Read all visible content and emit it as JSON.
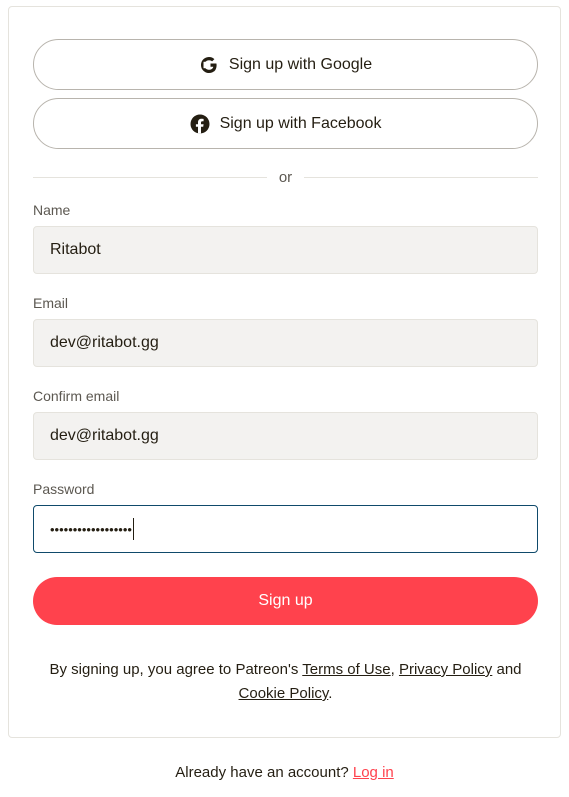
{
  "social": {
    "google_label": "Sign up with Google",
    "facebook_label": "Sign up with Facebook"
  },
  "divider": {
    "text": "or"
  },
  "form": {
    "name": {
      "label": "Name",
      "value": "Ritabot"
    },
    "email": {
      "label": "Email",
      "value": "dev@ritabot.gg"
    },
    "confirm_email": {
      "label": "Confirm email",
      "value": "dev@ritabot.gg"
    },
    "password": {
      "label": "Password",
      "masked_value": "••••••••••••••••••"
    }
  },
  "signup_button": {
    "label": "Sign up"
  },
  "terms": {
    "prefix": "By signing up, you agree to Patreon's ",
    "terms_link": "Terms of Use",
    "comma": ", ",
    "privacy_link": "Privacy Policy",
    "and": " and",
    "cookie_link": "Cookie Policy",
    "period": "."
  },
  "footer": {
    "prompt": "Already have an account? ",
    "login_link": "Log in"
  },
  "colors": {
    "accent": "#ff424d",
    "focus_border": "#0f4a6b",
    "input_bg": "#f3f2f0",
    "text": "#241e12"
  }
}
